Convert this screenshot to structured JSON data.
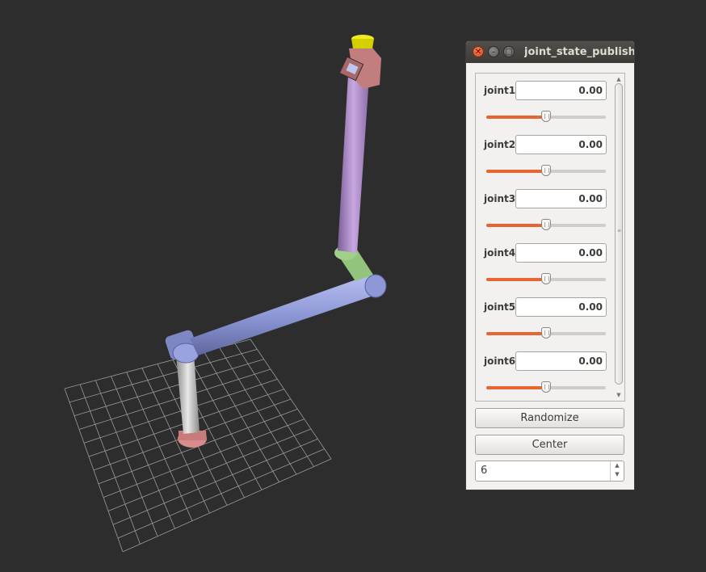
{
  "window": {
    "title": "joint_state_publisher",
    "close_icon": "✕",
    "minimize_icon": "–",
    "maximize_icon": "□"
  },
  "joints": [
    {
      "label": "joint1",
      "value": "0.00",
      "slider_fraction": 0.5
    },
    {
      "label": "joint2",
      "value": "0.00",
      "slider_fraction": 0.5
    },
    {
      "label": "joint3",
      "value": "0.00",
      "slider_fraction": 0.5
    },
    {
      "label": "joint4",
      "value": "0.00",
      "slider_fraction": 0.5
    },
    {
      "label": "joint5",
      "value": "0.00",
      "slider_fraction": 0.5
    },
    {
      "label": "joint6",
      "value": "0.00",
      "slider_fraction": 0.5
    }
  ],
  "buttons": {
    "randomize": "Randomize",
    "center": "Center"
  },
  "spinbox": {
    "value": "6"
  },
  "scrollbar": {
    "up_icon": "▲",
    "down_icon": "▼",
    "grip_icon": "≡"
  },
  "scene": {
    "background": "#2d2d2d",
    "grid_color": "#9a9a9a",
    "link_colors": {
      "base": "#d98c8c",
      "upper_arm": "#c0c0c0",
      "forearm": "#8e98d6",
      "elbow": "#93c47d",
      "wrist": "#b48fd0",
      "tool_body": "#c27e7e",
      "tool_tip": "#e4e000"
    }
  },
  "colors": {
    "slider_fill": "#e86430",
    "titlebar": "#3c3b37",
    "close_button": "#df4a16"
  }
}
